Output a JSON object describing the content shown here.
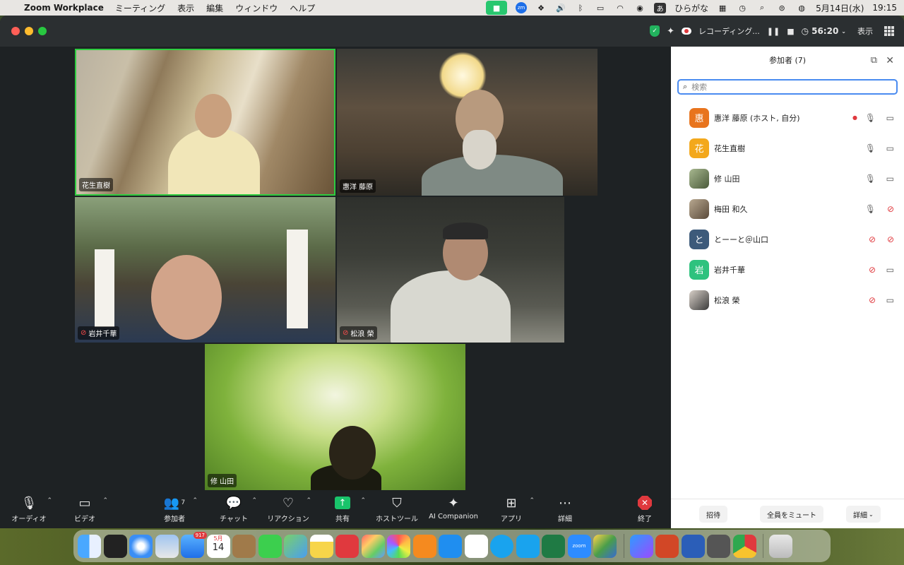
{
  "menubar": {
    "app_name": "Zoom Workplace",
    "menus": [
      "ミーティング",
      "表示",
      "編集",
      "ウィンドウ",
      "ヘルプ"
    ],
    "ime_char": "あ",
    "ime_label": "ひらがな",
    "zm_label": "zm",
    "date": "5月14日(水)",
    "time": "19:15"
  },
  "titlebar": {
    "recording_label": "レコーディング...",
    "timer": "56:20",
    "view_label": "表示"
  },
  "tiles": [
    {
      "name": "花生直樹",
      "muted": false
    },
    {
      "name": "惠洋 藤原",
      "muted": false
    },
    {
      "name": "岩井千華",
      "muted": true
    },
    {
      "name": "松浪 榮",
      "muted": true
    },
    {
      "name": "修 山田",
      "muted": false
    }
  ],
  "toolbar": {
    "audio": "オーディオ",
    "video": "ビデオ",
    "participants": "参加者",
    "participants_count": "7",
    "chat": "チャット",
    "reactions": "リアクション",
    "share": "共有",
    "host_tools": "ホストツール",
    "ai_companion": "AI Companion",
    "apps": "アプリ",
    "more": "詳細",
    "end": "終了"
  },
  "panel": {
    "title": "参加者 (7)",
    "search_placeholder": "検索",
    "participants": [
      {
        "avatar": "惠",
        "name": "惠洋 藤原 (ホスト, 自分)",
        "color": "#e8741e",
        "mic_muted": false,
        "cam_off": false
      },
      {
        "avatar": "花",
        "name": "花生直樹",
        "color": "#f3a81c",
        "mic_muted": false,
        "cam_off": false
      },
      {
        "avatar": "",
        "name": "修 山田",
        "color": "#8aa07a",
        "mic_muted": false,
        "cam_off": false
      },
      {
        "avatar": "",
        "name": "梅田 和久",
        "color": "#9a8a7a",
        "mic_muted": false,
        "cam_off": true
      },
      {
        "avatar": "と",
        "name": "とーーと＠山口",
        "color": "#3d5a7a",
        "mic_muted": true,
        "cam_off": true
      },
      {
        "avatar": "岩",
        "name": "岩井千華",
        "color": "#2ec27e",
        "mic_muted": true,
        "cam_off": false
      },
      {
        "avatar": "",
        "name": "松浪 榮",
        "color": "#6a6a6a",
        "mic_muted": true,
        "cam_off": false
      }
    ],
    "invite": "招待",
    "mute_all": "全員をミュート",
    "more": "詳細"
  },
  "dock": {
    "mail_badge": "917",
    "calendar_month": "5月",
    "calendar_day": "14",
    "zoom_label": "zoom"
  }
}
